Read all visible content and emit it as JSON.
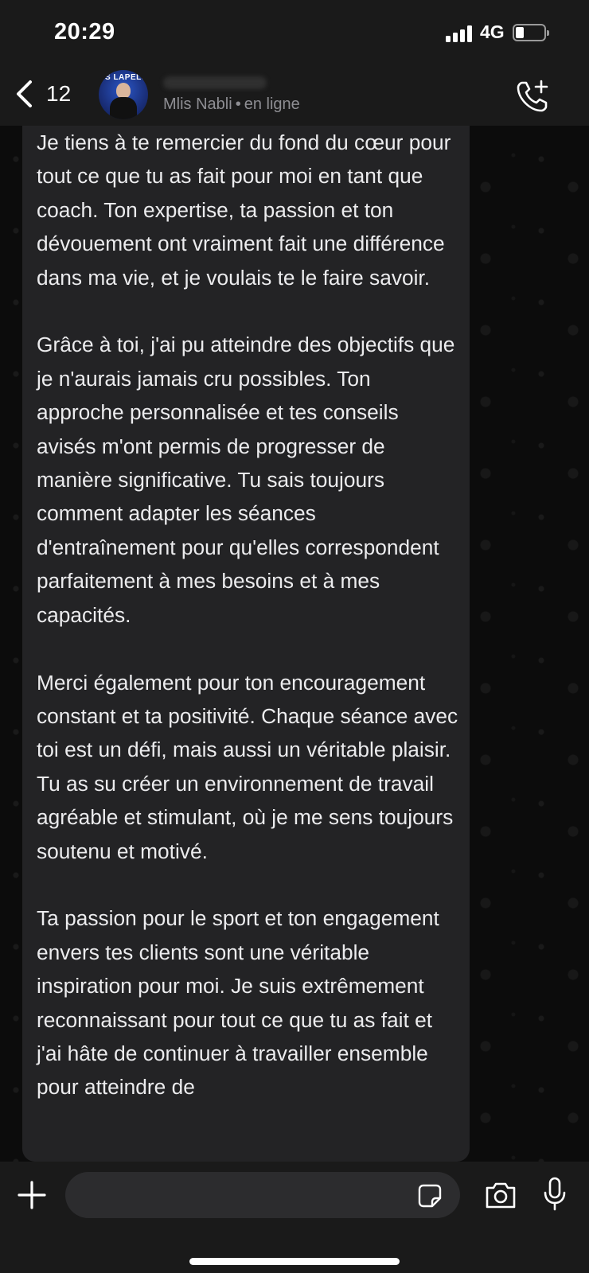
{
  "status_bar": {
    "time": "20:29",
    "network": "4G",
    "battery_level": 0.3
  },
  "header": {
    "back_count": "12",
    "contact_subtitle_name": "Mlis Nabli",
    "contact_status": "en ligne",
    "icons": [
      "chevron-left-icon",
      "call-add-icon"
    ]
  },
  "message": {
    "text": "Je tiens à te remercier du fond du cœur pour tout ce que tu as fait pour moi en tant que coach. Ton expertise, ta passion et ton dévouement ont vraiment fait une différence dans ma vie, et je voulais te le faire savoir.\n\nGrâce à toi, j'ai pu atteindre des objectifs que je n'aurais jamais cru possibles. Ton approche personnalisée et tes conseils avisés m'ont permis de progresser de manière significative. Tu sais toujours comment adapter les séances d'entraînement pour qu'elles correspondent parfaitement à mes besoins et à mes capacités.\n\nMerci également pour ton encouragement constant et ta positivité. Chaque séance avec toi est un défi, mais aussi un véritable plaisir. Tu as su créer un environnement de travail agréable et stimulant, où je me sens toujours soutenu et motivé.\n\nTa passion pour le sport et ton engagement envers tes clients sont une véritable inspiration pour moi. Je suis extrêmement reconnaissant pour tout ce que tu as fait et j'ai hâte de continuer à travailler ensemble pour atteindre de"
  },
  "composer": {
    "input_value": "",
    "icons": [
      "plus-icon",
      "sticker-icon",
      "camera-icon",
      "microphone-icon"
    ]
  },
  "colors": {
    "background": "#0b0b0b",
    "bar": "#1a1a1a",
    "bubble": "#232325",
    "text": "#ececee",
    "subtext": "#8e8e93"
  }
}
